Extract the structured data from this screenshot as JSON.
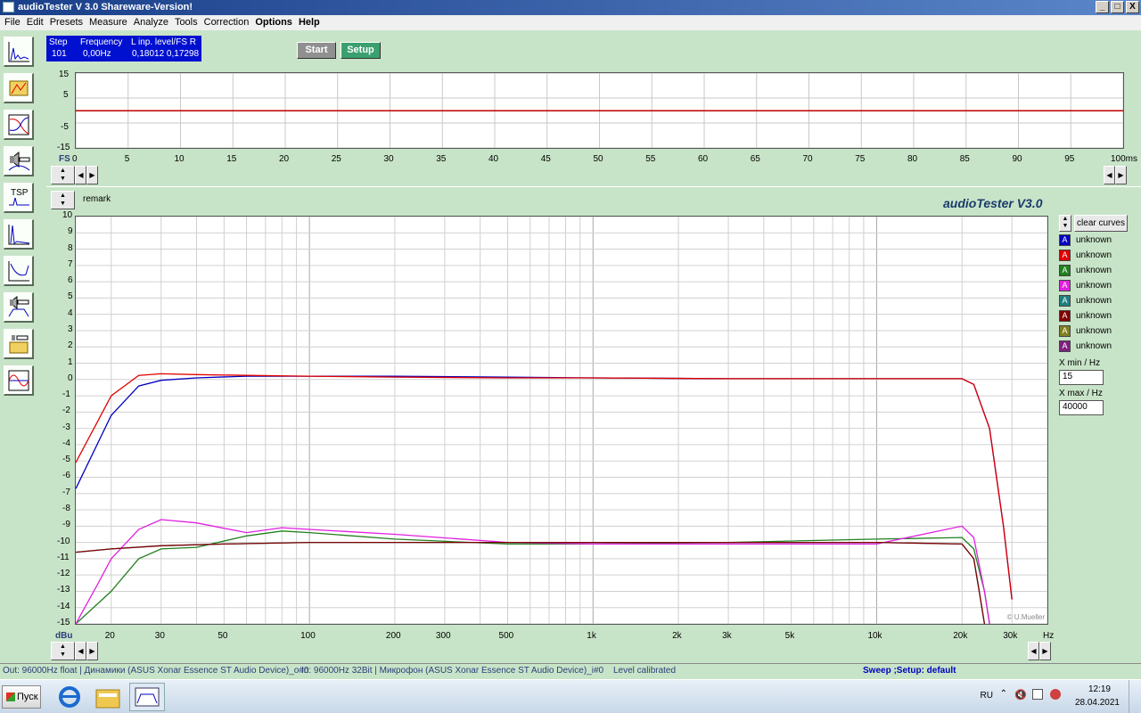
{
  "window": {
    "title": "audioTester  V 3.0 Shareware-Version!",
    "controls": [
      "_",
      "□",
      "X"
    ]
  },
  "menu": [
    "File",
    "Edit",
    "Presets",
    "Measure",
    "Analyze",
    "Tools",
    "Correction",
    "Options",
    "Help"
  ],
  "status_box": {
    "h1": "Step",
    "h2": "Frequency",
    "h3": "L  inp. level/FS  R",
    "step": "101",
    "freq": "0,00Hz",
    "levels": "0,18012 0,17298"
  },
  "buttons": {
    "start": "Start",
    "setup": "Setup"
  },
  "time_plot": {
    "y_ticks": [
      "15",
      "5",
      "-5",
      "-15"
    ],
    "x_ticks": [
      "0",
      "5",
      "10",
      "15",
      "20",
      "25",
      "30",
      "35",
      "40",
      "45",
      "50",
      "55",
      "60",
      "65",
      "70",
      "75",
      "80",
      "85",
      "90",
      "95"
    ],
    "x_prefix": "FS",
    "x_unit": "100ms"
  },
  "freq_plot": {
    "remark": "remark",
    "brand": "audioTester  V3.0",
    "copyright": "© U.Mueller",
    "y_unit": "dBu",
    "x_unit": "Hz",
    "y_ticks": [
      "10",
      "9",
      "8",
      "7",
      "6",
      "5",
      "4",
      "3",
      "2",
      "1",
      "0",
      "-1",
      "-2",
      "-3",
      "-4",
      "-5",
      "-6",
      "-7",
      "-8",
      "-9",
      "-10",
      "-11",
      "-12",
      "-13",
      "-14",
      "-15"
    ],
    "x_ticks": [
      "20",
      "30",
      "50",
      "100",
      "200",
      "300",
      "500",
      "1k",
      "2k",
      "3k",
      "5k",
      "10k",
      "20k",
      "30k"
    ]
  },
  "chart_data": {
    "type": "line",
    "x_scale": "log",
    "xlim": [
      15,
      40000
    ],
    "ylim": [
      -15,
      10
    ],
    "xlabel": "Hz",
    "ylabel": "dBu",
    "series": [
      {
        "name": "unknown",
        "color": "#0000c0",
        "x": [
          15,
          20,
          25,
          30,
          40,
          60,
          100,
          200,
          500,
          1000,
          3000,
          10000,
          20000,
          22000,
          25000,
          28000,
          30000
        ],
        "y": [
          -6.7,
          -2.2,
          -0.4,
          -0.05,
          0.1,
          0.2,
          0.2,
          0.2,
          0.15,
          0.1,
          0.05,
          0.05,
          0.05,
          -0.3,
          -3,
          -9,
          -13.5
        ]
      },
      {
        "name": "unknown",
        "color": "#e00000",
        "x": [
          15,
          20,
          25,
          30,
          40,
          60,
          100,
          200,
          500,
          1000,
          3000,
          10000,
          20000,
          22000,
          25000,
          28000,
          30000
        ],
        "y": [
          -5.1,
          -1.0,
          0.25,
          0.35,
          0.3,
          0.25,
          0.2,
          0.15,
          0.1,
          0.1,
          0.05,
          0.05,
          0.05,
          -0.3,
          -3,
          -9,
          -13.5
        ]
      },
      {
        "name": "unknown",
        "color": "#208020",
        "x": [
          15,
          20,
          25,
          30,
          40,
          60,
          80,
          100,
          200,
          500,
          1000,
          3000,
          10000,
          20000,
          22000,
          24000,
          25000
        ],
        "y": [
          -15,
          -13,
          -11,
          -10.4,
          -10.3,
          -9.6,
          -9.3,
          -9.4,
          -9.8,
          -10.1,
          -10.1,
          -10,
          -9.8,
          -9.7,
          -10.4,
          -13,
          -15
        ]
      },
      {
        "name": "unknown",
        "color": "#e020e0",
        "x": [
          15,
          18,
          20,
          25,
          30,
          40,
          60,
          80,
          100,
          200,
          500,
          1000,
          3000,
          10000,
          20000,
          22000,
          24000,
          25000
        ],
        "y": [
          -15,
          -12.5,
          -11,
          -9.2,
          -8.6,
          -8.8,
          -9.4,
          -9.1,
          -9.2,
          -9.5,
          -10,
          -10.1,
          -10.1,
          -10.1,
          -9,
          -9.7,
          -13,
          -15
        ]
      },
      {
        "name": "unknown",
        "color": "#208080",
        "x": [
          15,
          20,
          30,
          50,
          100,
          200,
          500,
          1000,
          3000,
          10000,
          20000,
          22000,
          23000,
          24000
        ],
        "y": [
          -10.6,
          -10.4,
          -10.2,
          -10.1,
          -10,
          -10,
          -10,
          -10,
          -10,
          -10,
          -10.1,
          -11,
          -13,
          -15
        ]
      },
      {
        "name": "unknown",
        "color": "#800000",
        "x": [
          15,
          20,
          30,
          50,
          100,
          200,
          500,
          1000,
          3000,
          10000,
          20000,
          22000,
          23000,
          24000
        ],
        "y": [
          -10.6,
          -10.4,
          -10.2,
          -10.1,
          -10,
          -10,
          -10,
          -10,
          -10,
          -10,
          -10.1,
          -11,
          -13,
          -15
        ]
      },
      {
        "name": "unknown",
        "color": "#808020",
        "x": [],
        "y": []
      },
      {
        "name": "unknown",
        "color": "#802080",
        "x": [],
        "y": []
      }
    ],
    "grid": true
  },
  "legend": {
    "clear_label": "clear curves",
    "items": [
      {
        "label": "unknown",
        "color": "#0000c0"
      },
      {
        "label": "unknown",
        "color": "#e00000"
      },
      {
        "label": "unknown",
        "color": "#208020"
      },
      {
        "label": "unknown",
        "color": "#e020e0"
      },
      {
        "label": "unknown",
        "color": "#208080"
      },
      {
        "label": "unknown",
        "color": "#800000"
      },
      {
        "label": "unknown",
        "color": "#808020"
      },
      {
        "label": "unknown",
        "color": "#802080"
      }
    ],
    "swatch_letter": "A"
  },
  "xrange": {
    "min_label": "X min / Hz",
    "min_value": "15",
    "max_label": "X max / Hz",
    "max_value": "40000"
  },
  "statusbar": {
    "out": "Out: 96000Hz float  | Динамики (ASUS Xonar Essence ST Audio Device)_o#0",
    "in": "In: 96000Hz 32Bit  | Микрофон (ASUS Xonar Essence ST Audio Device)_i#0",
    "level": "Level calibrated",
    "sweep": "Sweep ;Setup:  default"
  },
  "taskbar": {
    "start": "Пуск",
    "lang": "RU",
    "time": "12:19",
    "date": "28.04.2021"
  }
}
